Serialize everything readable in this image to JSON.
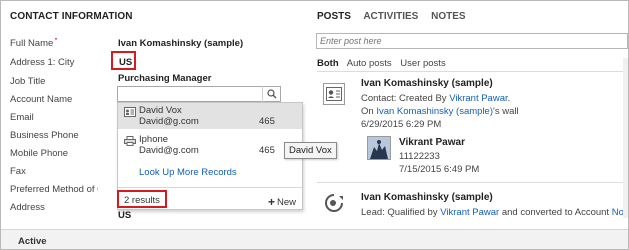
{
  "contact": {
    "header": "CONTACT INFORMATION",
    "fields": [
      {
        "label": "Full Name",
        "required": "*",
        "value": "Ivan Komashinsky (sample)"
      },
      {
        "label": "Address 1: City",
        "value": "US"
      },
      {
        "label": "Job Title",
        "value": "Purchasing Manager"
      },
      {
        "label": "Account Name",
        "value": ""
      },
      {
        "label": "Email"
      },
      {
        "label": "Business Phone"
      },
      {
        "label": "Mobile Phone"
      },
      {
        "label": "Fax"
      },
      {
        "label": "Preferred Method of C"
      },
      {
        "label": "Address"
      }
    ],
    "trailing_value": "US"
  },
  "lookup": {
    "results": [
      {
        "name": "David Vox",
        "email": "David@g.com",
        "number": "465",
        "icon": "contact-card-icon"
      },
      {
        "name": "Iphone",
        "email": "David@g.com",
        "number": "465",
        "icon": "printer-icon"
      }
    ],
    "more_link": "Look Up More Records",
    "results_count": "2 results",
    "new_label": "New",
    "tooltip": "David Vox"
  },
  "social": {
    "tabs": [
      "POSTS",
      "ACTIVITIES",
      "NOTES"
    ],
    "post_placeholder": "Enter post here",
    "filters": [
      "Both",
      "Auto posts",
      "User posts"
    ],
    "posts": [
      {
        "author": "Ivan Komashinsky (sample)",
        "line1_prefix": "Contact: Created By ",
        "line1_link": "Vikrant Pawar",
        "line1_suffix": ".",
        "line2_prefix": "On ",
        "line2_link": "Ivan Komashinsky (sample)",
        "line2_suffix": "'s wall",
        "date": "6/29/2015 6:29 PM",
        "icon": "contact-post-icon"
      },
      {
        "author": "Vikrant Pawar",
        "text": "11122233",
        "date": "7/15/2015 6:49 PM",
        "icon": "user-photo-icon"
      },
      {
        "author": "Ivan Komashinsky (sample)",
        "line1_prefix": "Lead: Qualified by ",
        "line1_link": "Vikrant Pawar",
        "line1_suffix": " and converted to Account ",
        "line1_link2": "Northw",
        "icon": "lead-qualified-icon"
      }
    ]
  },
  "status": {
    "text": "Active"
  },
  "colors": {
    "highlight": "#d71920",
    "link": "#1160b7",
    "required": "#d40000"
  }
}
